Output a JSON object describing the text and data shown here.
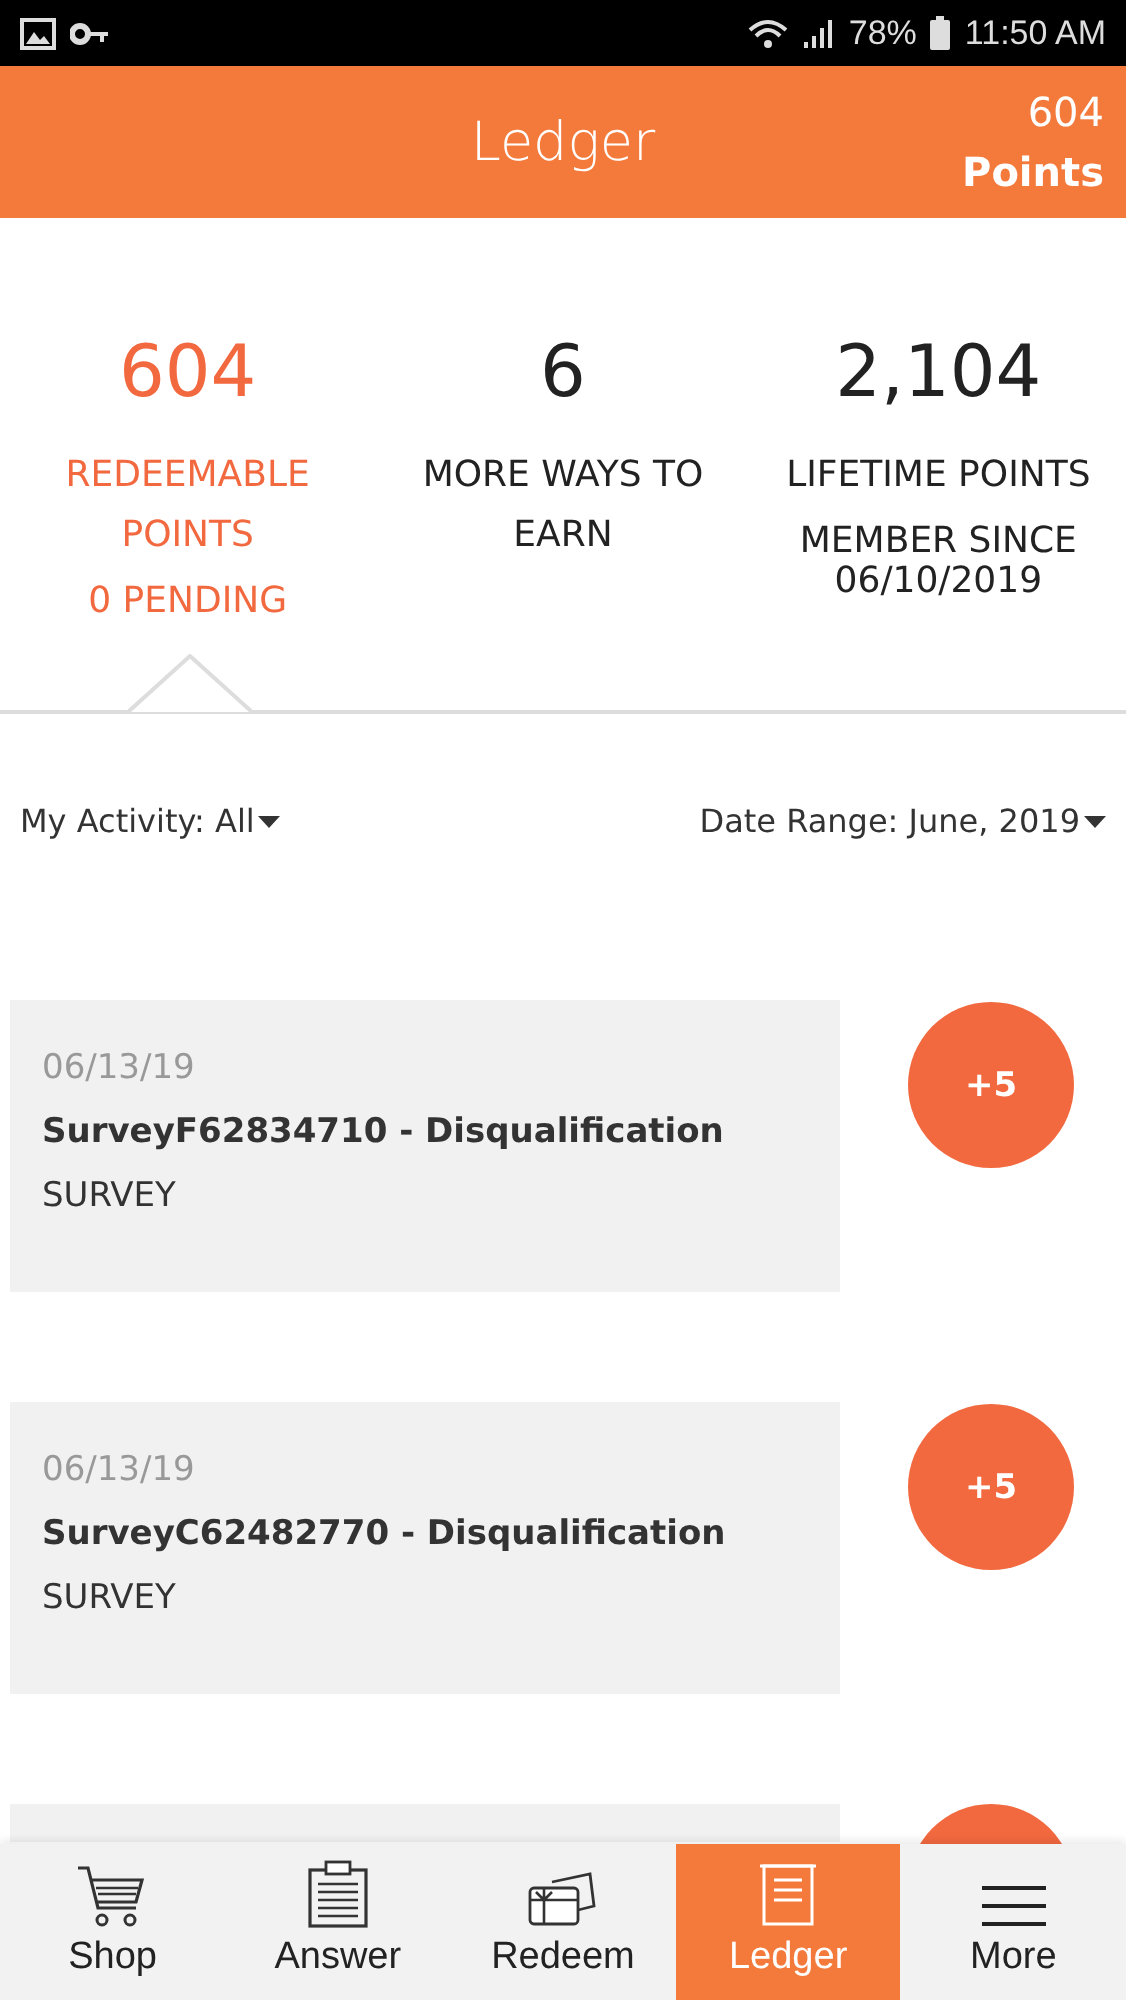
{
  "status_bar": {
    "battery": "78%",
    "time": "11:50 AM"
  },
  "header": {
    "title": "Ledger",
    "points_value": "604",
    "points_label": "Points"
  },
  "stats": [
    {
      "value": "604",
      "label": "REDEEMABLE POINTS",
      "extra": "0 PENDING",
      "selected": true
    },
    {
      "value": "6",
      "label": "MORE WAYS TO EARN",
      "selected": false
    },
    {
      "value": "2,104",
      "label": "LIFETIME POINTS",
      "extra": "MEMBER SINCE 06/10/2019",
      "selected": false
    }
  ],
  "filters": {
    "activity": "My Activity: All",
    "date_range": "Date Range: June, 2019"
  },
  "entries": [
    {
      "date": "06/13/19",
      "title": "SurveyF62834710 - Disqualification",
      "type": "SURVEY",
      "points": "+5"
    },
    {
      "date": "06/13/19",
      "title": "SurveyC62482770 - Disqualification",
      "type": "SURVEY",
      "points": "+5"
    }
  ],
  "nav": [
    {
      "label": "Shop",
      "kind": "cart",
      "selected": false
    },
    {
      "label": "Answer",
      "kind": "clipboard",
      "selected": false
    },
    {
      "label": "Redeem",
      "kind": "gift",
      "selected": false
    },
    {
      "label": "Ledger",
      "kind": "ledger",
      "selected": true
    },
    {
      "label": "More",
      "kind": "menu",
      "selected": false
    }
  ]
}
